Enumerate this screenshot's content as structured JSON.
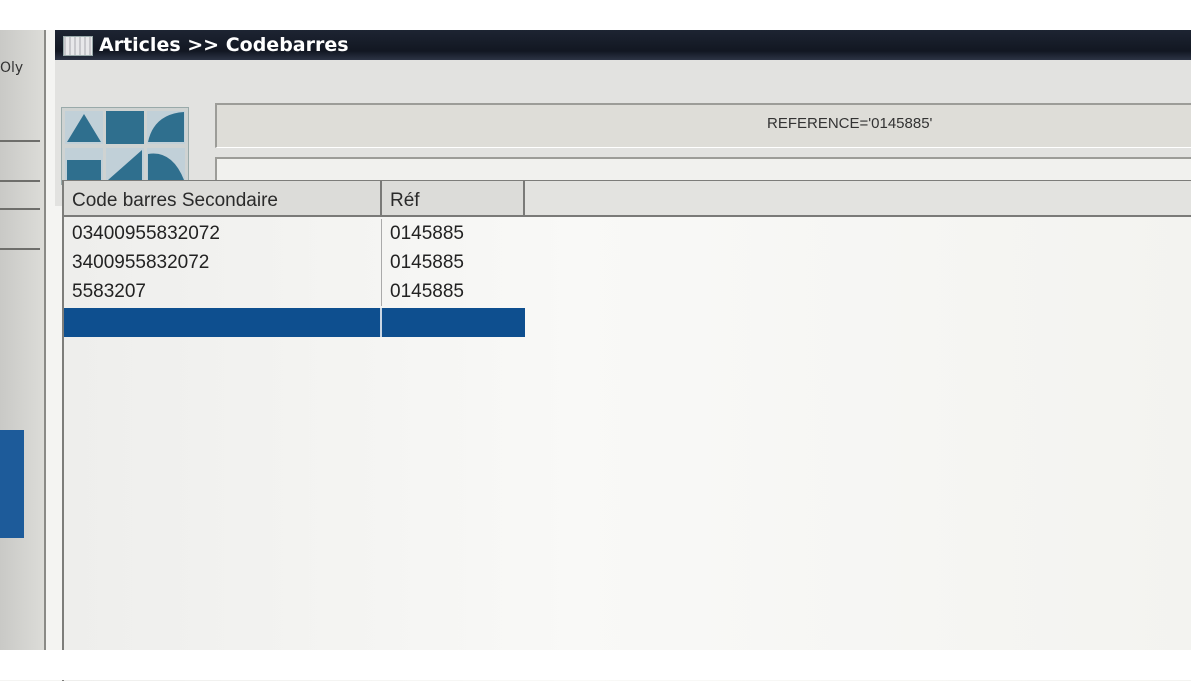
{
  "window": {
    "title": "Articles >> Codebarres"
  },
  "left_strip": {
    "cut_text": "Oly"
  },
  "filter": {
    "expression": "REFERENCE='0145885'",
    "second_field": ""
  },
  "grid": {
    "columns": [
      "Code barres Secondaire",
      "Réf",
      ""
    ],
    "rows": [
      {
        "code": "03400955832072",
        "ref": "0145885"
      },
      {
        "code": "3400955832072",
        "ref": "0145885"
      },
      {
        "code": "5583207",
        "ref": "0145885"
      },
      {
        "code": "",
        "ref": ""
      }
    ],
    "selected_row_index": 3
  },
  "colors": {
    "titlebar": "#121722",
    "selection": "#0e4f8f",
    "logo_tiles": "#2f6f8e"
  },
  "icons": {
    "window_icon": "window-grid-icon",
    "logo": "app-logo-icon"
  }
}
